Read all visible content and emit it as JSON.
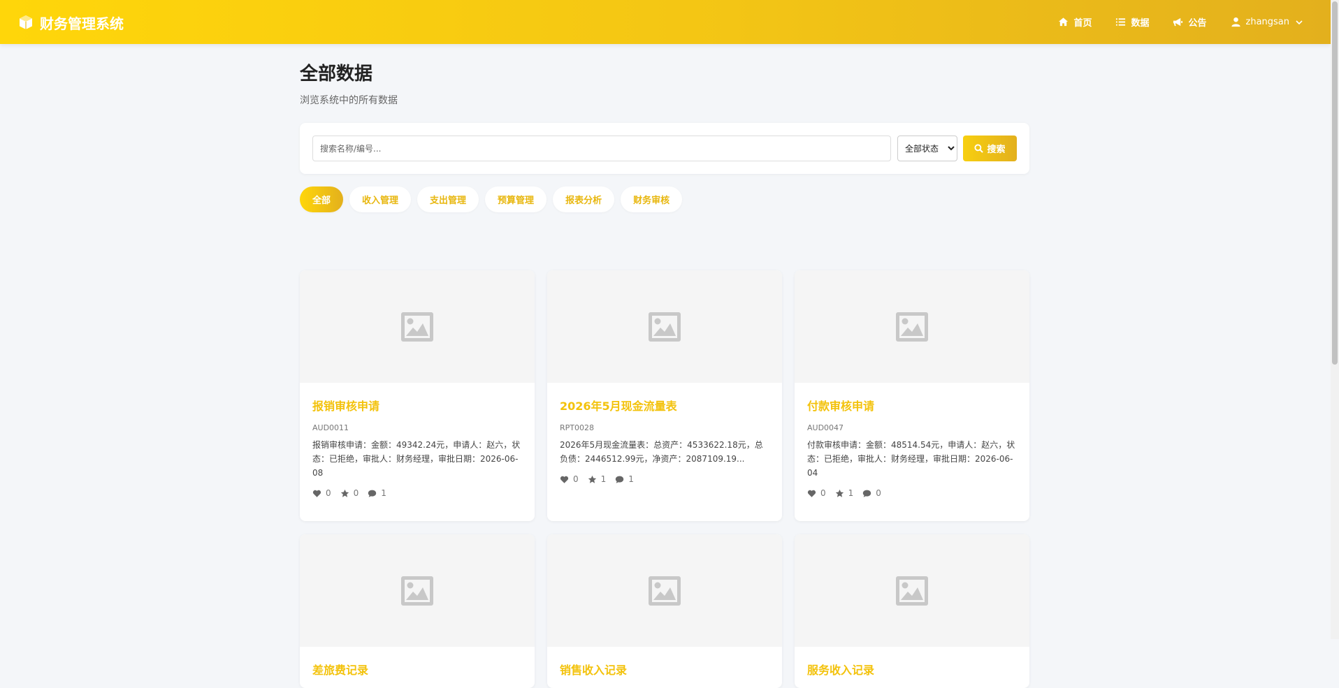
{
  "header": {
    "brand": "财务管理系统",
    "nav": [
      {
        "label": "首页",
        "icon": "home-icon"
      },
      {
        "label": "数据",
        "icon": "list-icon"
      },
      {
        "label": "公告",
        "icon": "megaphone-icon"
      }
    ],
    "user": "zhangsan"
  },
  "page": {
    "title": "全部数据",
    "subtitle": "浏览系统中的所有数据"
  },
  "search": {
    "placeholder": "搜索名称/编号...",
    "value": "",
    "status_selected": "全部状态",
    "button_label": "搜索"
  },
  "tabs": [
    "全部",
    "收入管理",
    "支出管理",
    "预算管理",
    "报表分析",
    "财务审核"
  ],
  "active_tab": "全部",
  "cards": [
    {
      "title": "报销审核申请",
      "code": "AUD0011",
      "desc": "报销审核申请：金额：49342.24元，申请人：赵六，状态：已拒绝，审批人：财务经理，审批日期：2026-06-08",
      "likes": "0",
      "favorites": "0",
      "comments": "1"
    },
    {
      "title": "2026年5月现金流量表",
      "code": "RPT0028",
      "desc": "2026年5月现金流量表：总资产：4533622.18元，总负债：2446512.99元，净资产：2087109.19...",
      "likes": "0",
      "favorites": "1",
      "comments": "1"
    },
    {
      "title": "付款审核申请",
      "code": "AUD0047",
      "desc": "付款审核申请：金额：48514.54元，申请人：赵六，状态：已拒绝，审批人：财务经理，审批日期：2026-06-04",
      "likes": "0",
      "favorites": "1",
      "comments": "0"
    },
    {
      "title": "差旅费记录",
      "code": "",
      "desc": "",
      "likes": "",
      "favorites": "",
      "comments": ""
    },
    {
      "title": "销售收入记录",
      "code": "",
      "desc": "",
      "likes": "",
      "favorites": "",
      "comments": ""
    },
    {
      "title": "服务收入记录",
      "code": "",
      "desc": "",
      "likes": "",
      "favorites": "",
      "comments": ""
    }
  ],
  "colors": {
    "accent": "#f3c20b",
    "header_start": "#ffd60a",
    "header_end": "#e3b01d",
    "background": "#f4f6f9"
  }
}
